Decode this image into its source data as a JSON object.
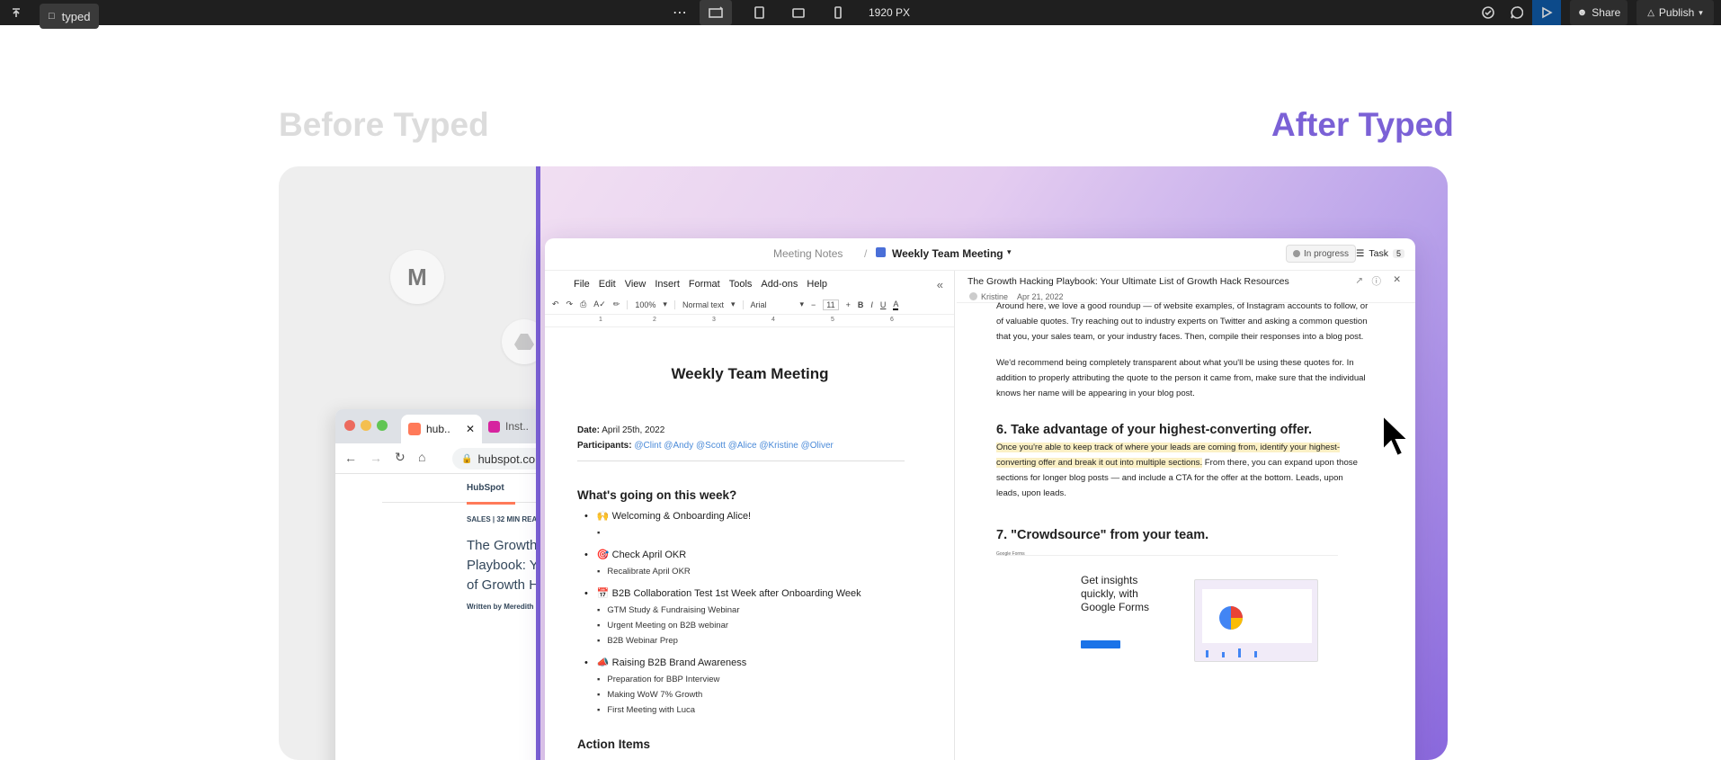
{
  "topbar": {
    "file_name": "typed",
    "more": "⋯",
    "width_label": "1920 PX",
    "share_label": "Share",
    "publish_label": "Publish"
  },
  "headings": {
    "before": "Before Typed",
    "after": "After Typed"
  },
  "left_panel": {
    "gmail_letter": "M",
    "browser": {
      "tab1": "hub..",
      "tab2": "Inst..",
      "url": "hubspot.co",
      "logo": "HubSpot",
      "category": "SALES | 32 MIN READ",
      "title_lines": [
        "The Growth",
        "Playbook: Y",
        "of Growth H"
      ],
      "author": "Written by Meredith"
    }
  },
  "app": {
    "breadcrumb_parent": "Meeting Notes",
    "breadcrumb_sep": "/",
    "breadcrumb_current": "Weekly Team Meeting",
    "status": "In progress",
    "task_label": "Task",
    "task_count": "5",
    "gdoc": {
      "menu": [
        "File",
        "Edit",
        "View",
        "Insert",
        "Format",
        "Tools",
        "Add-ons",
        "Help"
      ],
      "zoom": "100%",
      "style": "Normal text",
      "font": "Arial",
      "size": "11",
      "ruler": [
        "1",
        "2",
        "3",
        "4",
        "5",
        "6"
      ],
      "title": "Weekly Team Meeting",
      "date_label": "Date:",
      "date_value": "April 25th, 2022",
      "participants_label": "Participants:",
      "participants": "@Clint @Andy @Scott @Alice @Kristine @Oliver",
      "section1": "What's going on this week?",
      "groups": [
        {
          "icon": "🙌",
          "title": "Welcoming & Onboarding Alice!",
          "items": [
            ""
          ]
        },
        {
          "icon": "🎯",
          "title": "Check April OKR",
          "items": [
            "Recalibrate April OKR"
          ]
        },
        {
          "icon": "📅",
          "title": "B2B Collaboration Test 1st Week after Onboarding Week",
          "items": [
            "GTM Study & Fundraising Webinar",
            "Urgent Meeting on B2B webinar",
            "B2B Webinar Prep"
          ]
        },
        {
          "icon": "📣",
          "title": "Raising B2B Brand Awareness",
          "items": [
            "Preparation for BBP Interview",
            "Making WoW 7% Growth",
            "First Meeting with Luca"
          ]
        }
      ],
      "section2": "Action Items"
    },
    "blog": {
      "title": "The Growth Hacking Playbook: Your Ultimate List of Growth Hack Resources",
      "author": "Kristine",
      "date": "Apr 21, 2022",
      "p1": "Around here, we love a good roundup — of website examples, of Instagram accounts to follow, or of valuable quotes. Try reaching out to industry experts on Twitter and asking a common question that you, your sales team, or your industry faces. Then, compile their responses into a blog post.",
      "p2": "We'd recommend being completely transparent about what you'll be using these quotes for. In addition to properly attributing the quote to the person it came from, make sure that the individual knows her name will be appearing in your blog post.",
      "h6": "6. Take advantage of your highest-converting offer.",
      "p3_highlight": "Once you're able to keep track of where your leads are coming from, identify your highest-converting offer and break it out into multiple sections.",
      "p3_rest": " From there, you can expand upon those sections for longer blog posts — and include a CTA for the offer at the bottom. Leads, upon leads, upon leads.",
      "h7": "7. \"Crowdsource\" from your team.",
      "forms_brand": "Google Forms",
      "forms_headline": "Get insights quickly, with Google Forms"
    }
  },
  "colors": {
    "accent": "#7b61d6",
    "topbar": "#1f1f1f",
    "mention": "#4a8ad8",
    "highlight": "#fbf0c5"
  }
}
